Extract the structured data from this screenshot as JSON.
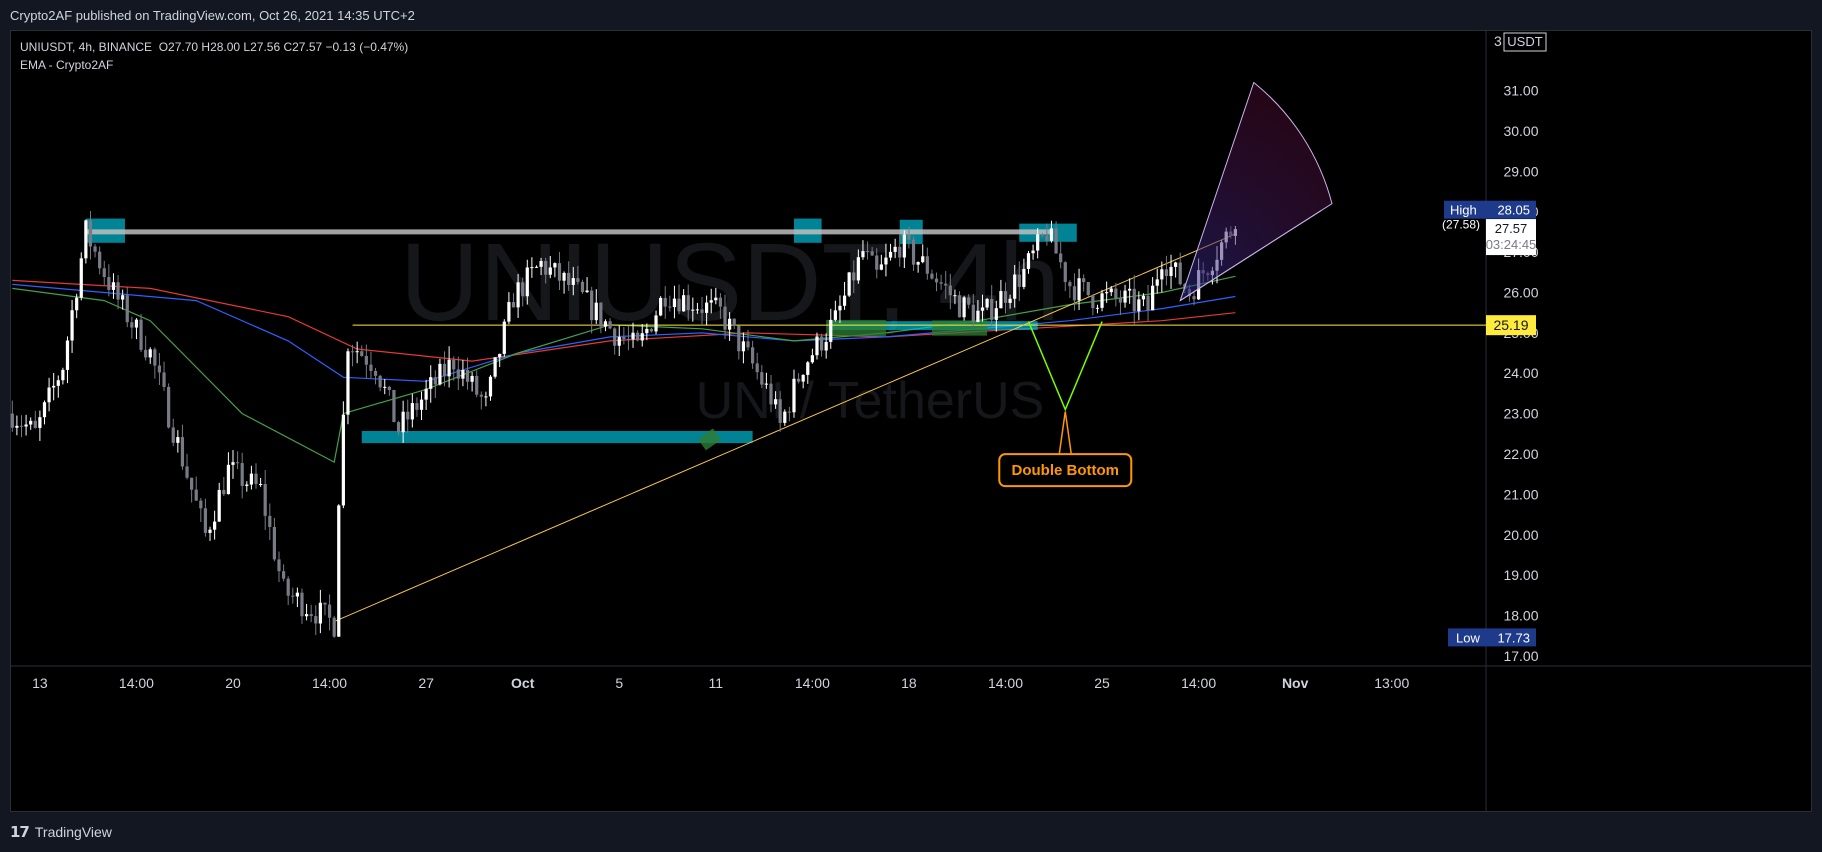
{
  "header": {
    "published": "Crypto2AF published on TradingView.com, Oct 26, 2021 14:35 UTC+2"
  },
  "legend": {
    "symbol": "UNIUSDT, 4h, BINANCE",
    "ohlc": "O27.70  H28.00  L27.56  C27.57  −0.13 (−0.47%)",
    "indicator": "EMA - Crypto2AF"
  },
  "watermark": {
    "big": "UNIUSDT, 4h",
    "small": "UNI / TetherUS"
  },
  "price_scale": {
    "currency": "USDT",
    "top_partial": "3",
    "high_label": "High",
    "high_value": "28.05",
    "paren_value": "(27.58)",
    "last_value": "27.57",
    "countdown": "03:24:45",
    "level_value": "25.19",
    "low_label": "Low",
    "low_value": "17.73"
  },
  "annotation": {
    "text": "Double Bottom"
  },
  "footer": {
    "brand": "TradingView"
  },
  "colors": {
    "background": "#000000",
    "up": "#ffffff",
    "down": "#787b86",
    "ema_red": "#e53935",
    "ema_blue": "#2962ff",
    "ema_green": "#43a047",
    "level": "#ffeb3b",
    "trend": "#f9c846",
    "box": "#00bcd4",
    "green_box": "#2e7d32",
    "annotation": "#ff9800",
    "v_line": "#76ff03"
  },
  "chart_data": {
    "type": "candlestick",
    "symbol": "UNIUSDT",
    "interval": "4h",
    "ylim": [
      16.75,
      32.5
    ],
    "y_ticks": [
      "31.00",
      "30.00",
      "29.00",
      "28.00",
      "27.00",
      "26.00",
      "25.00",
      "24.00",
      "23.00",
      "22.00",
      "21.00",
      "20.00",
      "19.00",
      "18.00",
      "17.00"
    ],
    "x_ticks": [
      "13",
      "14:00",
      "20",
      "14:00",
      "27",
      "Oct",
      "5",
      "11",
      "14:00",
      "18",
      "14:00",
      "25",
      "14:00",
      "Nov",
      "13:00"
    ],
    "x_tick_bars": [
      6,
      27,
      48,
      69,
      90,
      111,
      132,
      153,
      174,
      195,
      216,
      237,
      258,
      279,
      300
    ],
    "anchors": [
      [
        0,
        23.0
      ],
      [
        5,
        22.5
      ],
      [
        11,
        24.2
      ],
      [
        16,
        27.5
      ],
      [
        22,
        26.0
      ],
      [
        30,
        24.5
      ],
      [
        42,
        20.0
      ],
      [
        47,
        21.6
      ],
      [
        54,
        21.1
      ],
      [
        59,
        18.6
      ],
      [
        66,
        18.1
      ],
      [
        70,
        17.8
      ],
      [
        71,
        21.0
      ],
      [
        73,
        24.8
      ],
      [
        79,
        24.2
      ],
      [
        84,
        22.6
      ],
      [
        90,
        23.5
      ],
      [
        96,
        24.3
      ],
      [
        103,
        23.2
      ],
      [
        109,
        25.9
      ],
      [
        115,
        26.7
      ],
      [
        122,
        26.1
      ],
      [
        131,
        25.0
      ],
      [
        136,
        24.6
      ],
      [
        142,
        26.0
      ],
      [
        154,
        25.5
      ],
      [
        161,
        24.2
      ],
      [
        165,
        23.4
      ],
      [
        167,
        22.7
      ],
      [
        172,
        24.2
      ],
      [
        179,
        25.3
      ],
      [
        185,
        27.0
      ],
      [
        188,
        26.4
      ],
      [
        193,
        27.2
      ],
      [
        199,
        26.6
      ],
      [
        206,
        25.7
      ],
      [
        211,
        25.4
      ],
      [
        220,
        26.5
      ],
      [
        225,
        27.5
      ],
      [
        230,
        26.2
      ],
      [
        235,
        25.9
      ],
      [
        242,
        25.8
      ],
      [
        247,
        25.6
      ],
      [
        250,
        26.9
      ],
      [
        256,
        26.0
      ],
      [
        263,
        27.2
      ],
      [
        266,
        27.7
      ]
    ],
    "ema_fast": [
      [
        0,
        26.1
      ],
      [
        20,
        25.8
      ],
      [
        30,
        25.3
      ],
      [
        50,
        23.0
      ],
      [
        70,
        21.8
      ],
      [
        72,
        23.0
      ],
      [
        90,
        23.6
      ],
      [
        110,
        24.5
      ],
      [
        130,
        25.2
      ],
      [
        150,
        25.1
      ],
      [
        170,
        24.8
      ],
      [
        190,
        25.0
      ],
      [
        210,
        25.3
      ],
      [
        230,
        25.7
      ],
      [
        250,
        26.0
      ],
      [
        266,
        26.4
      ]
    ],
    "ema_mid": [
      [
        0,
        26.2
      ],
      [
        20,
        26.0
      ],
      [
        40,
        25.8
      ],
      [
        60,
        24.8
      ],
      [
        72,
        23.9
      ],
      [
        90,
        23.8
      ],
      [
        110,
        24.5
      ],
      [
        130,
        24.9
      ],
      [
        150,
        25.0
      ],
      [
        170,
        24.8
      ],
      [
        190,
        24.9
      ],
      [
        210,
        25.1
      ],
      [
        230,
        25.3
      ],
      [
        250,
        25.6
      ],
      [
        266,
        25.9
      ]
    ],
    "ema_slow": [
      [
        0,
        26.3
      ],
      [
        30,
        26.1
      ],
      [
        60,
        25.4
      ],
      [
        75,
        24.6
      ],
      [
        100,
        24.3
      ],
      [
        130,
        24.8
      ],
      [
        160,
        25.0
      ],
      [
        190,
        24.9
      ],
      [
        220,
        25.1
      ],
      [
        250,
        25.3
      ],
      [
        266,
        25.5
      ]
    ],
    "resistance": 27.5,
    "support_level": 25.19,
    "trendline": [
      [
        70,
        17.85
      ],
      [
        266,
        27.45
      ]
    ],
    "fan": {
      "origin": [
        254,
        25.8
      ],
      "rays": [
        [
          270,
          31.2
        ],
        [
          287,
          28.2
        ]
      ]
    },
    "double_bottom": {
      "left_top": [
        [
          221,
          25.28
        ],
        [
          237,
          25.28
        ]
      ],
      "apex": [
        229,
        23.1
      ],
      "label_at": [
        229,
        21.6
      ]
    },
    "last_price": 27.57,
    "high": 28.05,
    "low": 17.73
  }
}
